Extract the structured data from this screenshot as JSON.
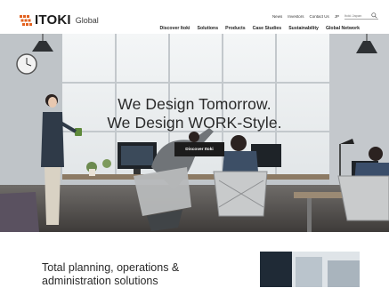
{
  "header": {
    "logo_text": "ITOKI",
    "logo_sub": "Global",
    "utility_links": [
      "News",
      "Investors",
      "Contact Us"
    ],
    "language": "JP",
    "search_placeholder": "Itoki Japan",
    "nav": [
      "Discover Itoki",
      "Solutions",
      "Products",
      "Case Studies",
      "Sustainability",
      "Global Network"
    ]
  },
  "hero": {
    "headline_line1": "We Design Tomorrow.",
    "headline_line2": "We Design WORK-Style.",
    "cta_label": "Discover Itoki"
  },
  "lower": {
    "title": "Total planning, operations & administration solutions"
  },
  "colors": {
    "logo_accent": "#e2611f",
    "text_dark": "#222222",
    "cta_bg": "#1c1c1c"
  }
}
